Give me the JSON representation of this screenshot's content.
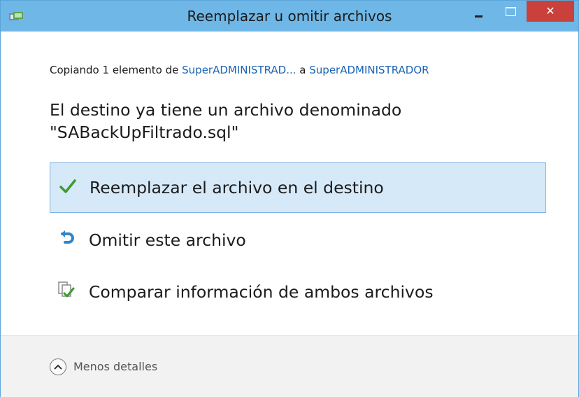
{
  "window": {
    "title": "Reemplazar u omitir archivos",
    "close_glyph": "✕",
    "accent_color": "#6fb7e6",
    "close_color": "#c9413a"
  },
  "copy_status": {
    "prefix": "Copiando 1 elemento de ",
    "source": "SuperADMINISTRAD...",
    "middle": " a ",
    "destination": "SuperADMINISTRADOR"
  },
  "message": {
    "line1": "El destino ya tiene un archivo denominado",
    "line2": "\"SABackUpFiltrado.sql\""
  },
  "options": [
    {
      "label": "Reemplazar el archivo en el destino",
      "icon": "checkmark-icon",
      "selected": true
    },
    {
      "label": "Omitir este archivo",
      "icon": "skip-arrow-icon",
      "selected": false
    },
    {
      "label": "Comparar información de ambos archivos",
      "icon": "compare-files-icon",
      "selected": false
    }
  ],
  "footer": {
    "details_label": "Menos detalles",
    "details_icon": "chevron-up-icon"
  }
}
